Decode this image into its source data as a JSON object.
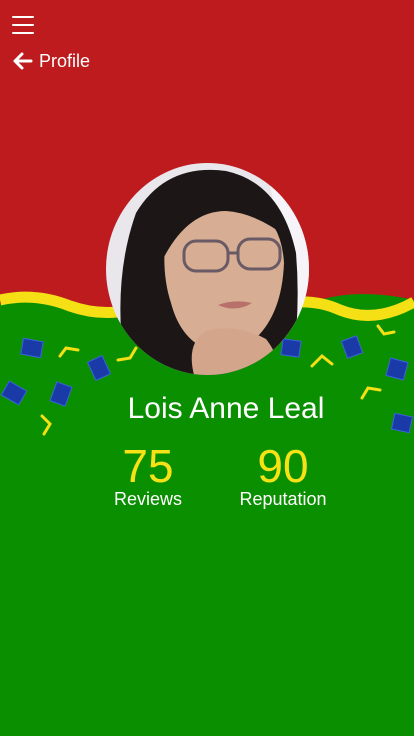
{
  "colors": {
    "top_band": "#be1b1f",
    "bottom": "#0a8f00",
    "wave": "#f4e014",
    "accent_text": "#f7e315",
    "confetti_blue": "#1a3aa8"
  },
  "header": {
    "title": "Profile",
    "menu_icon": "hamburger-icon",
    "back_icon": "arrow-left-icon"
  },
  "profile": {
    "name": "Lois Anne Leal",
    "avatar": "user-avatar"
  },
  "stats": [
    {
      "value": "75",
      "label": "Reviews"
    },
    {
      "value": "90",
      "label": "Reputation"
    }
  ]
}
